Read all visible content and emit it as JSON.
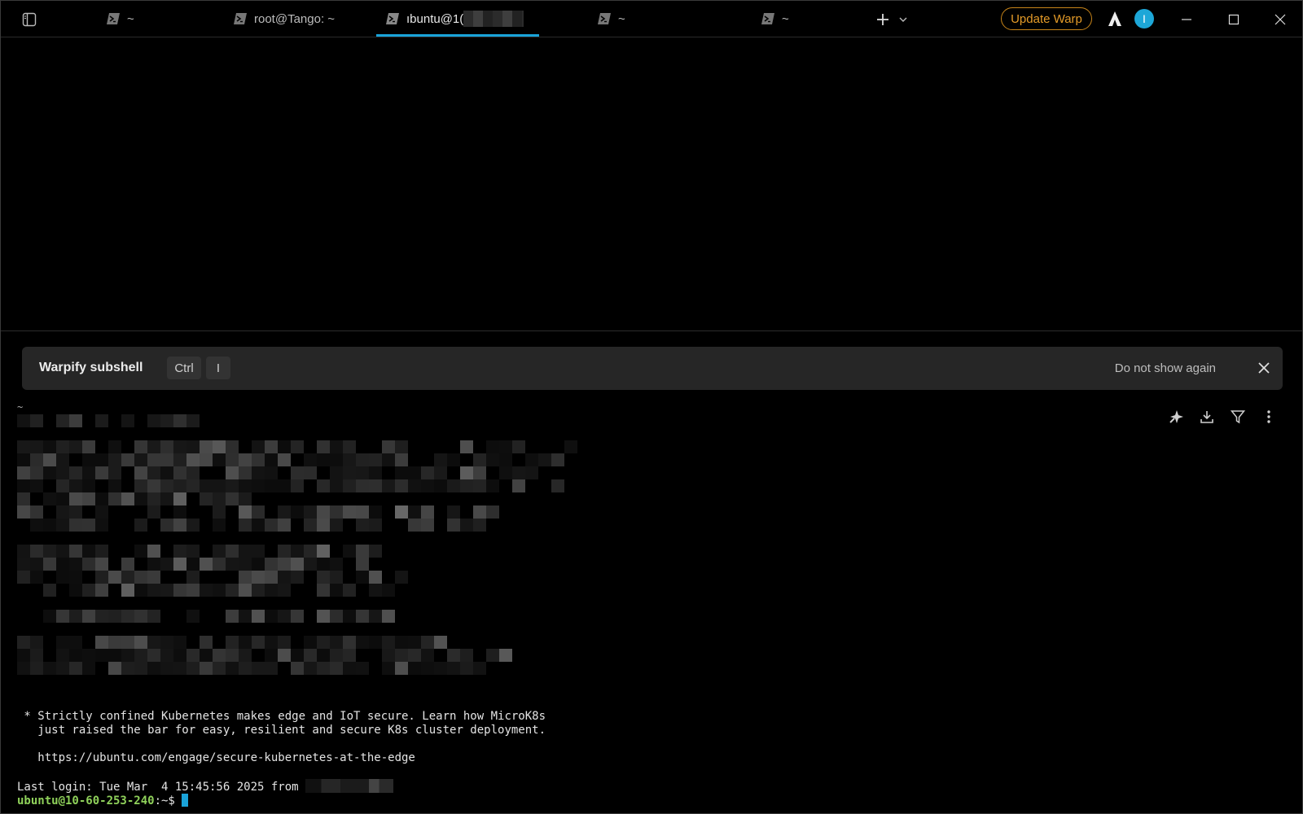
{
  "titlebar": {
    "tabs": [
      {
        "title": "~",
        "active": false
      },
      {
        "title": "root@Tango: ~",
        "active": false
      },
      {
        "title": "ıbuntu@1(",
        "active": true
      },
      {
        "title": "~",
        "active": false
      },
      {
        "title": "~",
        "active": false
      }
    ],
    "update_label": "Update Warp",
    "avatar_initial": "I"
  },
  "banner": {
    "title": "Warpify subshell",
    "key1": "Ctrl",
    "key2": "I",
    "dismiss_label": "Do not show again"
  },
  "terminal": {
    "cwd_marker": "~",
    "motd_line1": " * Strictly confined Kubernetes makes edge and IoT secure. Learn how MicroK8s",
    "motd_line2": "   just raised the bar for easy, resilient and secure K8s cluster deployment.",
    "motd_url": "   https://ubuntu.com/engage/secure-kubernetes-at-the-edge",
    "last_login": "Last login: Tue Mar  4 15:45:56 2025 from ",
    "prompt_user": "ubuntu@10-60-253-240",
    "prompt_rest": ":~$ "
  },
  "colors": {
    "accent": "#19a3d9",
    "update": "#e39a28",
    "prompt_user": "#8fd15a"
  },
  "icons": {
    "sidebar": "sidebar-toggle-icon",
    "tab": "powershell-icon",
    "new_tab": "plus-icon",
    "tab_menu": "chevron-down-icon",
    "warp_logo": "warp-logo-icon",
    "minimize": "minimize-icon",
    "maximize": "maximize-icon",
    "close": "close-icon",
    "ai": "sparkle-icon",
    "download": "download-icon",
    "filter": "filter-icon",
    "more": "more-vertical-icon"
  }
}
